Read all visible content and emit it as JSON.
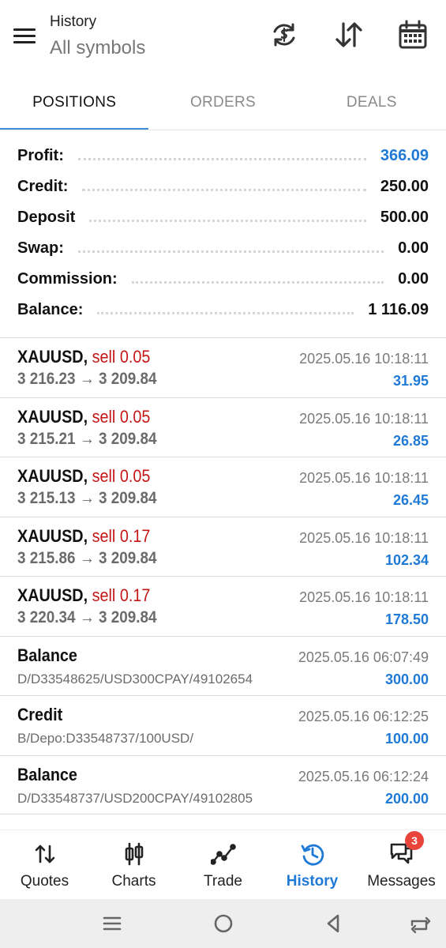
{
  "header": {
    "subtitle": "History",
    "title": "All symbols",
    "icons": [
      "menu-icon",
      "sync-icon",
      "sort-icon",
      "calendar-icon"
    ]
  },
  "tabs": [
    {
      "label": "POSITIONS",
      "active": true
    },
    {
      "label": "ORDERS",
      "active": false
    },
    {
      "label": "DEALS",
      "active": false
    }
  ],
  "summary": [
    {
      "label": "Profit:",
      "value": "366.09",
      "highlight": true
    },
    {
      "label": "Credit:",
      "value": "250.00",
      "highlight": false
    },
    {
      "label": "Deposit",
      "value": "500.00",
      "highlight": false
    },
    {
      "label": "Swap:",
      "value": "0.00",
      "highlight": false
    },
    {
      "label": "Commission:",
      "value": "0.00",
      "highlight": false
    },
    {
      "label": "Balance:",
      "value": "1 116.09",
      "highlight": false
    }
  ],
  "positions": [
    {
      "symbol": "XAUUSD,",
      "side": "sell 0.05",
      "open": "3 216.23",
      "close": "3 209.84",
      "time": "2025.05.16 10:18:11",
      "profit": "31.95"
    },
    {
      "symbol": "XAUUSD,",
      "side": "sell 0.05",
      "open": "3 215.21",
      "close": "3 209.84",
      "time": "2025.05.16 10:18:11",
      "profit": "26.85"
    },
    {
      "symbol": "XAUUSD,",
      "side": "sell 0.05",
      "open": "3 215.13",
      "close": "3 209.84",
      "time": "2025.05.16 10:18:11",
      "profit": "26.45"
    },
    {
      "symbol": "XAUUSD,",
      "side": "sell 0.17",
      "open": "3 215.86",
      "close": "3 209.84",
      "time": "2025.05.16 10:18:11",
      "profit": "102.34"
    },
    {
      "symbol": "XAUUSD,",
      "side": "sell 0.17",
      "open": "3 220.34",
      "close": "3 209.84",
      "time": "2025.05.16 10:18:11",
      "profit": "178.50"
    }
  ],
  "operations": [
    {
      "type": "Balance",
      "comment": "D/D33548625/USD300CPAY/49102654",
      "time": "2025.05.16 06:07:49",
      "amount": "300.00"
    },
    {
      "type": "Credit",
      "comment": "B/Depo:D33548737/100USD/",
      "time": "2025.05.16 06:12:25",
      "amount": "100.00"
    },
    {
      "type": "Balance",
      "comment": "D/D33548737/USD200CPAY/49102805",
      "time": "2025.05.16 06:12:24",
      "amount": "200.00"
    }
  ],
  "arrow": "→",
  "bottom_nav": [
    {
      "label": "Quotes",
      "icon": "quotes-icon",
      "active": false
    },
    {
      "label": "Charts",
      "icon": "charts-icon",
      "active": false
    },
    {
      "label": "Trade",
      "icon": "trade-icon",
      "active": false
    },
    {
      "label": "History",
      "icon": "history-icon",
      "active": true
    },
    {
      "label": "Messages",
      "icon": "messages-icon",
      "active": false,
      "badge": "3"
    }
  ],
  "colors": {
    "accent": "#1f7ad6",
    "sell": "#c41515",
    "badge": "#e8443a",
    "tab_indicator": "#3f8fd8"
  }
}
